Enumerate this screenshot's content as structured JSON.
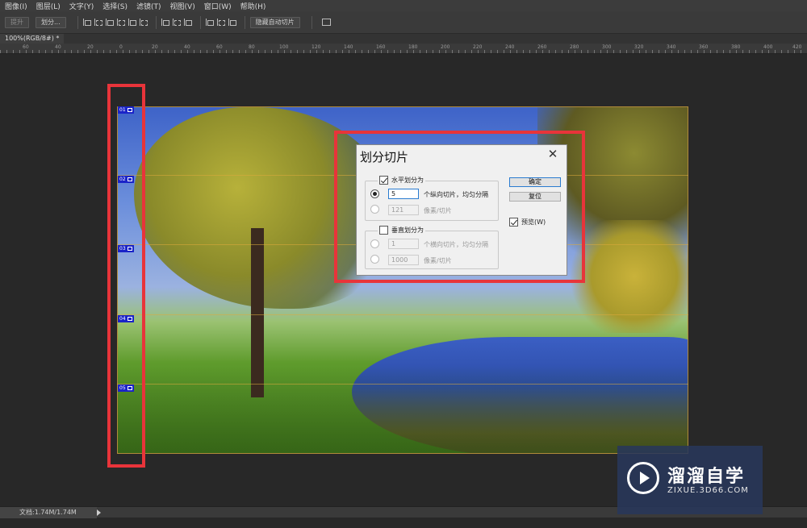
{
  "menubar": {
    "items": [
      "图像(I)",
      "图层(L)",
      "文字(Y)",
      "选择(S)",
      "滤镜(T)",
      "视图(V)",
      "窗口(W)",
      "帮助(H)"
    ]
  },
  "optionsbar": {
    "promote_label": "提升",
    "divide_label": "划分...",
    "hide_auto_slices_label": "隐藏自动切片"
  },
  "document_tab": {
    "label": "100%(RGB/8#) *"
  },
  "ruler": {
    "ticks": [
      "60",
      "40",
      "20",
      "0",
      "20",
      "40",
      "60",
      "80",
      "100",
      "120",
      "140",
      "160",
      "180",
      "200",
      "220",
      "240",
      "260",
      "280",
      "300",
      "320",
      "340",
      "360",
      "380",
      "400",
      "420"
    ]
  },
  "slices": {
    "badges": [
      "01",
      "02",
      "03",
      "04",
      "05"
    ]
  },
  "dialog": {
    "title": "划分切片",
    "close_glyph": "✕",
    "horizontal": {
      "label": "水平划分为",
      "checked": true,
      "count_value": "5",
      "count_label": "个纵向切片，均匀分隔",
      "pixel_value": "121",
      "pixel_label": "像素/切片"
    },
    "vertical": {
      "label": "垂直划分为",
      "checked": false,
      "count_value": "1",
      "count_label": "个横向切片，均匀分隔",
      "pixel_value": "1000",
      "pixel_label": "像素/切片"
    },
    "ok_label": "确定",
    "reset_label": "复位",
    "preview_label": "预览(W)",
    "preview_checked": true
  },
  "statusbar": {
    "doc_info": "文档:1.74M/1.74M"
  },
  "watermark": {
    "title": "溜溜自学",
    "subtitle": "ZIXUE.3D66.COM"
  },
  "colors": {
    "highlight": "#e8343a",
    "slice_badge": "#1a23c8"
  },
  "icons": [
    "align-icon",
    "folder-icon",
    "close-icon",
    "play-logo-icon"
  ]
}
